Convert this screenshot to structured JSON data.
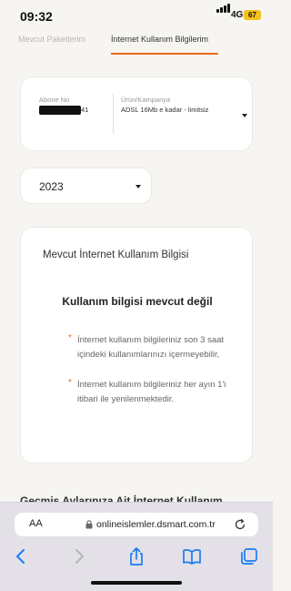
{
  "status_bar": {
    "time": "09:32",
    "network": "4G",
    "battery": "67"
  },
  "tabs": {
    "packages_label": "Mevcut Paketlerim",
    "usage_label": "İnternet Kullanım Bilgilerim",
    "active_color": "#f06b1f"
  },
  "subscription": {
    "subscriber_no_label": "Abone No",
    "subscriber_no_visible": "41",
    "product_label": "Ürün/Kampanya",
    "product_value": "ADSL 16Mb e kadar - limitsiz"
  },
  "year_select": {
    "value": "2023"
  },
  "usage_info": {
    "title": "Mevcut İnternet Kullanım Bilgisi",
    "subtitle": "Kullanım bilgisi mevcut değil",
    "notes": [
      "İnternet kullanım bilgileriniz son 3 saat içindeki kullanımlarınızı içermeyebilir,",
      "İnternet kullanım bilgileriniz her ayın 1'i itibari ile yenilenmektedir."
    ],
    "bullet": "*"
  },
  "section_heading": "Geçmiş Aylarınıza Ait İnternet Kullanım",
  "browser": {
    "aa_label": "AA",
    "url": "onlineislemler.dsmart.com.tr",
    "icons": [
      "lock-icon",
      "reload-icon",
      "back-icon",
      "forward-icon",
      "share-icon",
      "bookmarks-icon",
      "tabs-icon"
    ]
  },
  "colors": {
    "accent": "#f06b1f",
    "background": "#f7f5f2",
    "browser_bar": "#e3e1e7",
    "safari_blue": "#1a7cf5"
  }
}
